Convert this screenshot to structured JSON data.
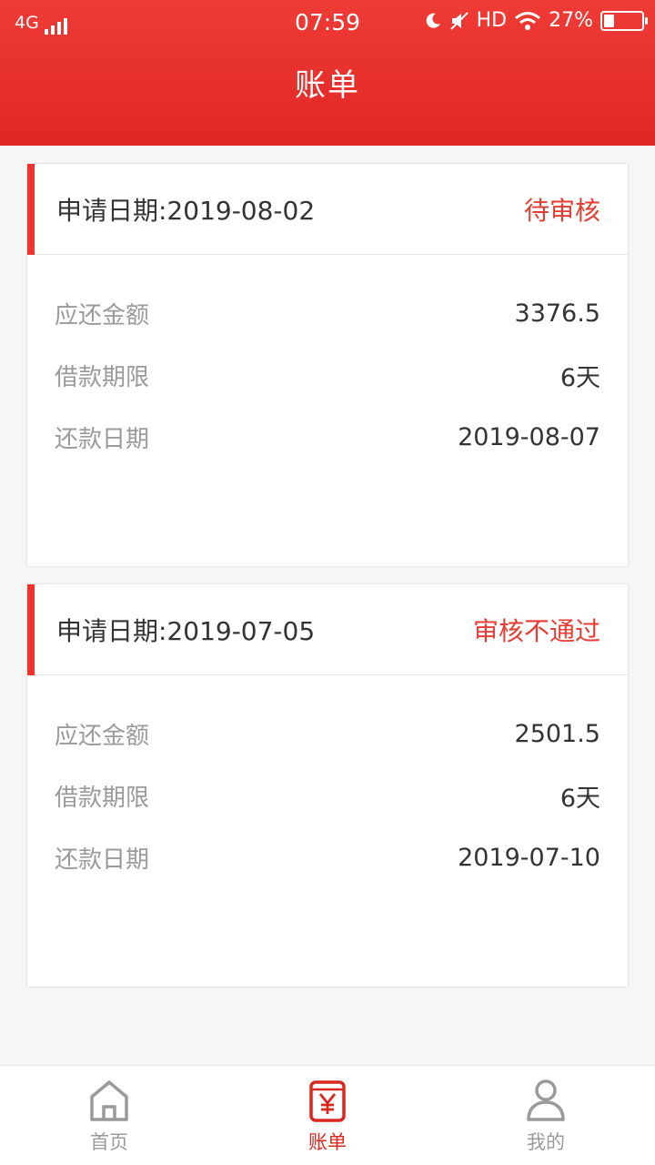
{
  "status_bar": {
    "network": "4G",
    "time": "07:59",
    "hd": "HD",
    "battery": "27%",
    "battery_level": 0.27
  },
  "header": {
    "title": "账单"
  },
  "bills": [
    {
      "apply_date": "申请日期:2019-08-02",
      "status": "待审核",
      "rows": [
        {
          "key": "应还金额",
          "value": "3376.5"
        },
        {
          "key": "借款期限",
          "value": "6天"
        },
        {
          "key": "还款日期",
          "value": "2019-08-07"
        }
      ]
    },
    {
      "apply_date": "申请日期:2019-07-05",
      "status": "审核不通过",
      "rows": [
        {
          "key": "应还金额",
          "value": "2501.5"
        },
        {
          "key": "借款期限",
          "value": "6天"
        },
        {
          "key": "还款日期",
          "value": "2019-07-10"
        }
      ]
    }
  ],
  "tabbar": {
    "items": [
      {
        "label": "首页",
        "icon": "home-icon"
      },
      {
        "label": "账单",
        "icon": "bill-icon"
      },
      {
        "label": "我的",
        "icon": "user-icon"
      }
    ],
    "active_index": 1,
    "active_color": "#d9281f",
    "inactive_color": "#9a9a9a"
  }
}
